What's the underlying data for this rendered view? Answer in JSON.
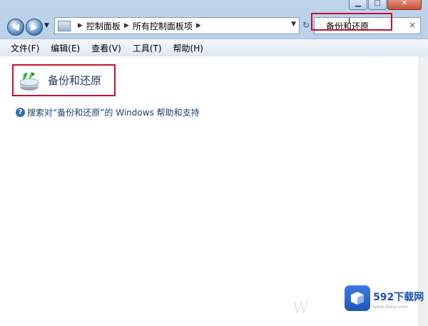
{
  "window": {
    "min_glyph": "▁",
    "max_glyph": "□",
    "close_glyph": "✕"
  },
  "nav": {
    "back_glyph": "◀",
    "forward_glyph": "▶",
    "recent_glyph": "▼",
    "crumbs": [
      "控制面板",
      "所有控制面板项"
    ],
    "sep_glyph": "▶",
    "dropdown_glyph": "▼",
    "refresh_glyph": "↻",
    "search_value": "备份和还原",
    "search_clear": "×"
  },
  "menu": [
    "文件(F)",
    "编辑(E)",
    "查看(V)",
    "工具(T)",
    "帮助(H)"
  ],
  "result": {
    "title": "备份和还原",
    "icon": "backup-restore-icon"
  },
  "help": {
    "glyph": "?",
    "text": "搜索对“备份和还原”的 Windows 帮助和支持"
  },
  "watermark": {
    "brand": "592下载网",
    "site": "www.592xz.com",
    "win_text": "W"
  },
  "colors": {
    "highlight": "#c8102e",
    "link": "#1a3e72"
  }
}
